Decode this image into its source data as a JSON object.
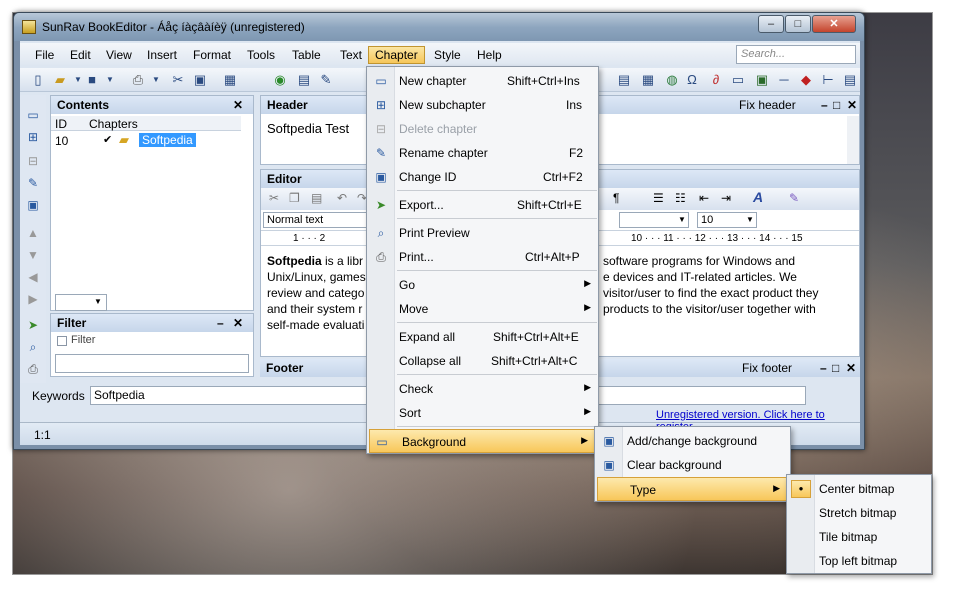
{
  "window": {
    "title": "SunRav BookEditor - Áåç íàçâàíèÿ (unregistered)"
  },
  "menubar": [
    "File",
    "Edit",
    "View",
    "Insert",
    "Format",
    "Tools",
    "Table",
    "Text",
    "Chapter",
    "Style",
    "Help"
  ],
  "search": {
    "placeholder": "Search..."
  },
  "contents": {
    "title": "Contents",
    "col_id": "ID",
    "col_chapters": "Chapters",
    "row": {
      "id": "10",
      "name": "Softpedia",
      "checked": true
    }
  },
  "filter": {
    "title": "Filter",
    "checkbox_label": "Filter"
  },
  "header_panel": {
    "title": "Header",
    "fix_label": "Fix header",
    "text": "Softpedia Test"
  },
  "editor_panel": {
    "title": "Editor",
    "style_value": "Normal text",
    "font_size_value": "10",
    "ruler_left": "1 · · · 2",
    "ruler_right": "10 · · · 11 · · · 12 · · · 13 · · · 14 · · · 15",
    "body_bold": "Softpedia",
    "body_line1": " is a libr",
    "body_line2": "Unix/Linux, games",
    "body_line3": "review and catego",
    "body_line4": "and their system r",
    "body_line5": "self-made evaluati",
    "body_right1": "software programs for Windows and",
    "body_right2": "e devices and IT-related articles. We",
    "body_right3": "visitor/user to find the exact product they",
    "body_right4": "products to the visitor/user together with"
  },
  "footer_panel": {
    "title": "Footer",
    "fix_label": "Fix footer"
  },
  "keywords": {
    "label": "Keywords",
    "value": "Softpedia"
  },
  "status": {
    "position": "1:1",
    "register_link": "Unregistered version. Click here to register."
  },
  "chapter_menu": [
    {
      "label": "New chapter",
      "shortcut": "Shift+Ctrl+Ins",
      "icon": "folder-icon"
    },
    {
      "label": "New subchapter",
      "shortcut": "Ins",
      "icon": "subchapter-icon"
    },
    {
      "label": "Delete chapter",
      "shortcut": "",
      "icon": "delete-chapter-icon",
      "disabled": true
    },
    {
      "label": "Rename chapter",
      "shortcut": "F2",
      "icon": "rename-icon"
    },
    {
      "label": "Change ID",
      "shortcut": "Ctrl+F2",
      "icon": "change-id-icon"
    },
    {
      "label": "Export...",
      "shortcut": "Shift+Ctrl+E",
      "icon": "export-icon"
    },
    {
      "label": "Print Preview",
      "shortcut": "",
      "icon": "print-preview-icon"
    },
    {
      "label": "Print...",
      "shortcut": "Ctrl+Alt+P",
      "icon": "print-icon"
    },
    {
      "label": "Go",
      "shortcut": "",
      "submenu": true
    },
    {
      "label": "Move",
      "shortcut": "",
      "submenu": true
    },
    {
      "label": "Expand all",
      "shortcut": "Shift+Ctrl+Alt+E"
    },
    {
      "label": "Collapse all",
      "shortcut": "Shift+Ctrl+Alt+C"
    },
    {
      "label": "Check",
      "shortcut": "",
      "submenu": true
    },
    {
      "label": "Sort",
      "shortcut": "",
      "submenu": true
    },
    {
      "label": "Background",
      "shortcut": "",
      "submenu": true,
      "highlighted": true,
      "icon": "background-icon"
    }
  ],
  "background_menu": [
    {
      "label": "Add/change background",
      "icon": "add-background-icon"
    },
    {
      "label": "Clear background",
      "icon": "clear-background-icon"
    },
    {
      "label": "Type",
      "submenu": true,
      "highlighted": true
    }
  ],
  "type_menu": [
    {
      "label": "Center bitmap",
      "selected": true
    },
    {
      "label": "Stretch bitmap"
    },
    {
      "label": "Tile bitmap"
    },
    {
      "label": "Top left bitmap"
    }
  ],
  "colors": {
    "accent_highlight": "#f8c75a",
    "link": "#0000cc",
    "selection": "#3399ff"
  }
}
